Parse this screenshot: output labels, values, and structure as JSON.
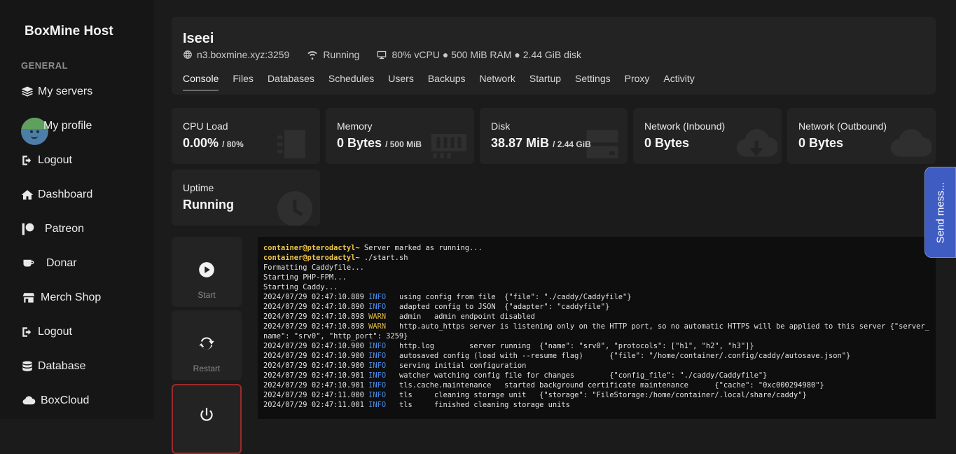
{
  "brand": "BoxMine Host",
  "sidebar": {
    "section": "GENERAL",
    "items": [
      {
        "label": "My servers",
        "icon": "layers-icon"
      },
      {
        "label": "My profile",
        "icon": "avatar"
      },
      {
        "label": "Logout",
        "icon": "logout-icon"
      },
      {
        "label": "Dashboard",
        "icon": "home-icon"
      },
      {
        "label": "Patreon",
        "icon": "patreon-icon"
      },
      {
        "label": "Donar",
        "icon": "coffee-icon"
      },
      {
        "label": "Merch Shop",
        "icon": "store-icon"
      },
      {
        "label": "Logout",
        "icon": "logout-icon"
      },
      {
        "label": "Database",
        "icon": "database-icon"
      },
      {
        "label": "BoxCloud",
        "icon": "cloud-icon"
      }
    ]
  },
  "server": {
    "name": "Iseei",
    "address": "n3.boxmine.xyz:3259",
    "status": "Running",
    "resources": "80% vCPU ● 500 MiB RAM ● 2.44 GiB disk"
  },
  "tabs": [
    "Console",
    "Files",
    "Databases",
    "Schedules",
    "Users",
    "Backups",
    "Network",
    "Startup",
    "Settings",
    "Proxy",
    "Activity"
  ],
  "stats": {
    "cpu": {
      "title": "CPU Load",
      "value": "0.00%",
      "limit": "/ 80%"
    },
    "memory": {
      "title": "Memory",
      "value": "0 Bytes",
      "limit": "/ 500 MiB"
    },
    "disk": {
      "title": "Disk",
      "value": "38.87 MiB",
      "limit": "/ 2.44 GiB"
    },
    "net_in": {
      "title": "Network (Inbound)",
      "value": "0 Bytes"
    },
    "net_out": {
      "title": "Network (Outbound)",
      "value": "0 Bytes"
    },
    "uptime": {
      "title": "Uptime",
      "value": "Running"
    }
  },
  "controls": {
    "start": "Start",
    "restart": "Restart"
  },
  "console": {
    "lines": [
      {
        "prompt": "container@pterodactyl~",
        "text": " Server marked as running..."
      },
      {
        "prompt": "container@pterodactyl~",
        "text": " ./start.sh"
      },
      {
        "text": "Formatting Caddyfile..."
      },
      {
        "text": "Starting PHP-FPM..."
      },
      {
        "text": "Starting Caddy..."
      },
      {
        "ts": "2024/07/29 02:47:10.889",
        "level": "INFO",
        "text": "   using config from file  {\"file\": \"./caddy/Caddyfile\"}"
      },
      {
        "ts": "2024/07/29 02:47:10.890",
        "level": "INFO",
        "text": "   adapted config to JSON  {\"adapter\": \"caddyfile\"}"
      },
      {
        "ts": "2024/07/29 02:47:10.898",
        "level": "WARN",
        "text": "   admin   admin endpoint disabled"
      },
      {
        "ts": "2024/07/29 02:47:10.898",
        "level": "WARN",
        "text": "   http.auto_https server is listening only on the HTTP port, so no automatic HTTPS will be applied to this server {\"server_name\": \"srv0\", \"http_port\": 3259}"
      },
      {
        "ts": "2024/07/29 02:47:10.900",
        "level": "INFO",
        "text": "   http.log        server running  {\"name\": \"srv0\", \"protocols\": [\"h1\", \"h2\", \"h3\"]}"
      },
      {
        "ts": "2024/07/29 02:47:10.900",
        "level": "INFO",
        "text": "   autosaved config (load with --resume flag)      {\"file\": \"/home/container/.config/caddy/autosave.json\"}"
      },
      {
        "ts": "2024/07/29 02:47:10.900",
        "level": "INFO",
        "text": "   serving initial configuration"
      },
      {
        "ts": "2024/07/29 02:47:10.901",
        "level": "INFO",
        "text": "   watcher watching config file for changes        {\"config_file\": \"./caddy/Caddyfile\"}"
      },
      {
        "ts": "2024/07/29 02:47:10.901",
        "level": "INFO",
        "text": "   tls.cache.maintenance   started background certificate maintenance      {\"cache\": \"0xc000294980\"}"
      },
      {
        "ts": "2024/07/29 02:47:11.000",
        "level": "INFO",
        "text": "   tls     cleaning storage unit   {\"storage\": \"FileStorage:/home/container/.local/share/caddy\"}"
      },
      {
        "ts": "2024/07/29 02:47:11.001",
        "level": "INFO",
        "text": "   tls     finished cleaning storage units"
      }
    ]
  },
  "feedback": "Send mess..."
}
